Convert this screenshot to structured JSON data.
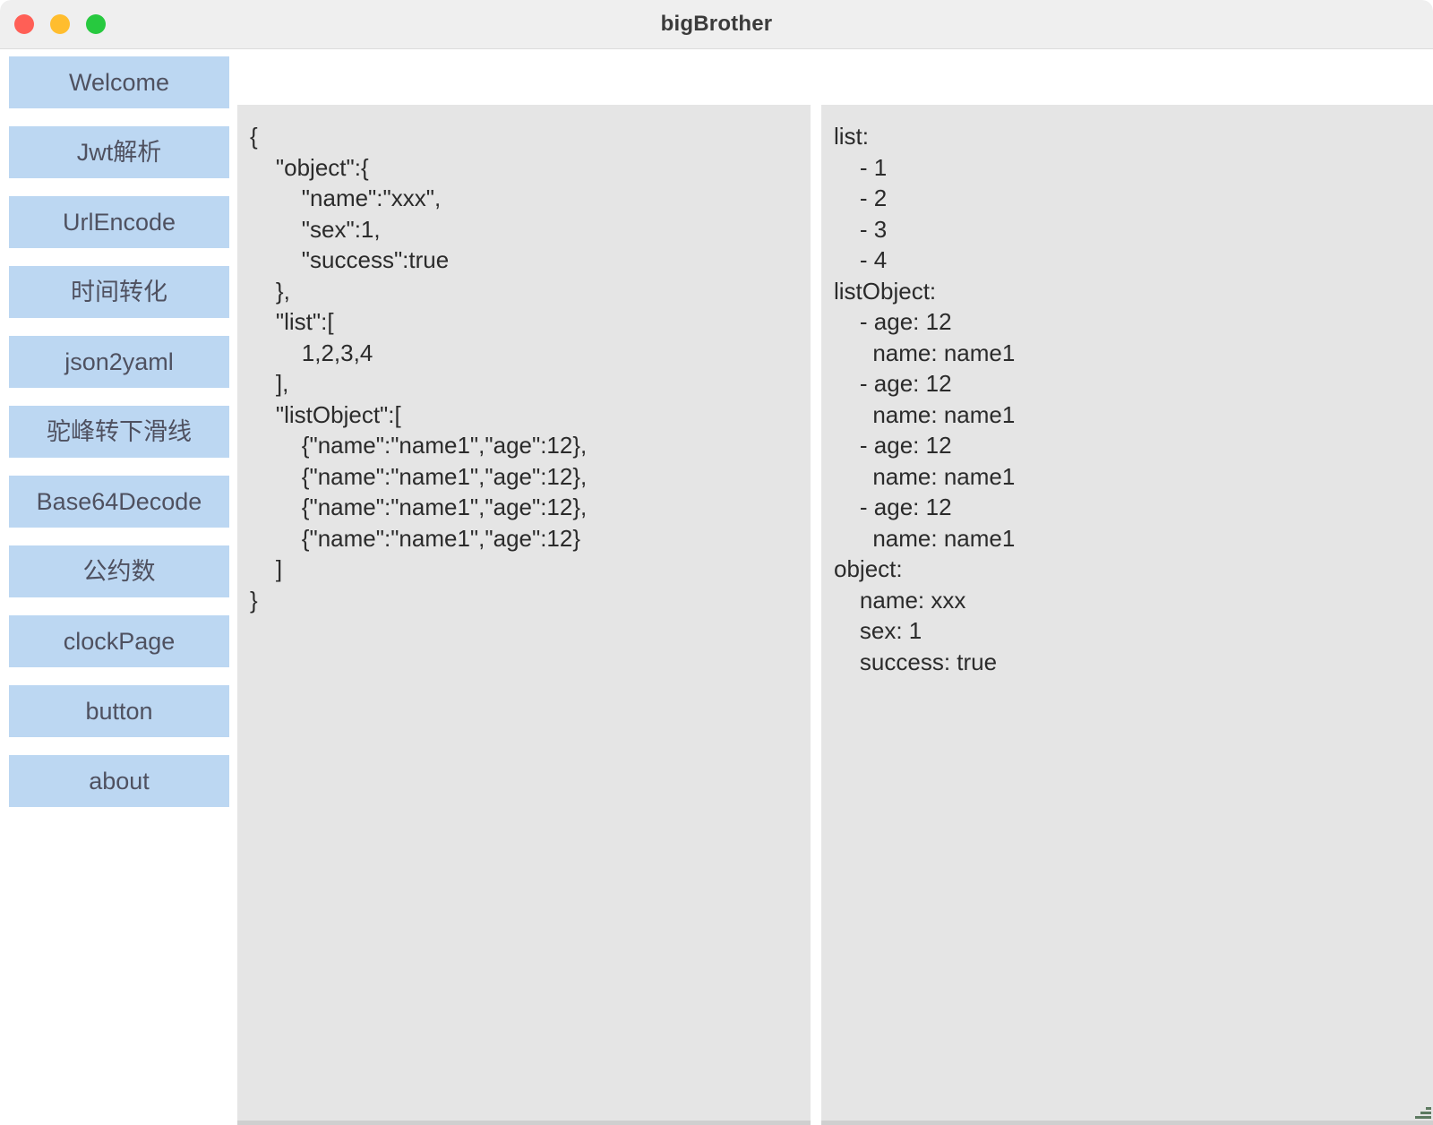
{
  "window": {
    "title": "bigBrother",
    "traffic_lights": [
      {
        "name": "close",
        "color": "#ff5f56"
      },
      {
        "name": "minimize",
        "color": "#ffbd2e"
      },
      {
        "name": "maximize",
        "color": "#27c93f"
      }
    ]
  },
  "theme": {
    "nav_background": "#bcd7f2",
    "nav_text": "#4f5160",
    "panel_background": "#e5e5e5",
    "titlebar_background": "#efefef",
    "code_text": "#2b2b2b"
  },
  "sidebar": {
    "items": [
      {
        "label": "Welcome",
        "name": "sidebar-item-welcome"
      },
      {
        "label": "Jwt解析",
        "name": "sidebar-item-jwt-parse"
      },
      {
        "label": "UrlEncode",
        "name": "sidebar-item-urlencode"
      },
      {
        "label": "时间转化",
        "name": "sidebar-item-time-convert"
      },
      {
        "label": "json2yaml",
        "name": "sidebar-item-json2yaml"
      },
      {
        "label": "驼峰转下滑线",
        "name": "sidebar-item-camel-to-underscore"
      },
      {
        "label": "Base64Decode",
        "name": "sidebar-item-base64decode"
      },
      {
        "label": "公约数",
        "name": "sidebar-item-common-divisor"
      },
      {
        "label": "clockPage",
        "name": "sidebar-item-clockpage"
      },
      {
        "label": "button",
        "name": "sidebar-item-button"
      },
      {
        "label": "about",
        "name": "sidebar-item-about"
      }
    ]
  },
  "editors": {
    "input": {
      "value": "{\n    \"object\":{\n        \"name\":\"xxx\",\n        \"sex\":1,\n        \"success\":true\n    },\n    \"list\":[\n        1,2,3,4\n    ],\n    \"listObject\":[\n        {\"name\":\"name1\",\"age\":12},\n        {\"name\":\"name1\",\"age\":12},\n        {\"name\":\"name1\",\"age\":12},\n        {\"name\":\"name1\",\"age\":12}\n    ]\n}"
    },
    "output": {
      "value": "list:\n    - 1\n    - 2\n    - 3\n    - 4\nlistObject:\n    - age: 12\n      name: name1\n    - age: 12\n      name: name1\n    - age: 12\n      name: name1\n    - age: 12\n      name: name1\nobject:\n    name: xxx\n    sex: 1\n    success: true"
    }
  }
}
